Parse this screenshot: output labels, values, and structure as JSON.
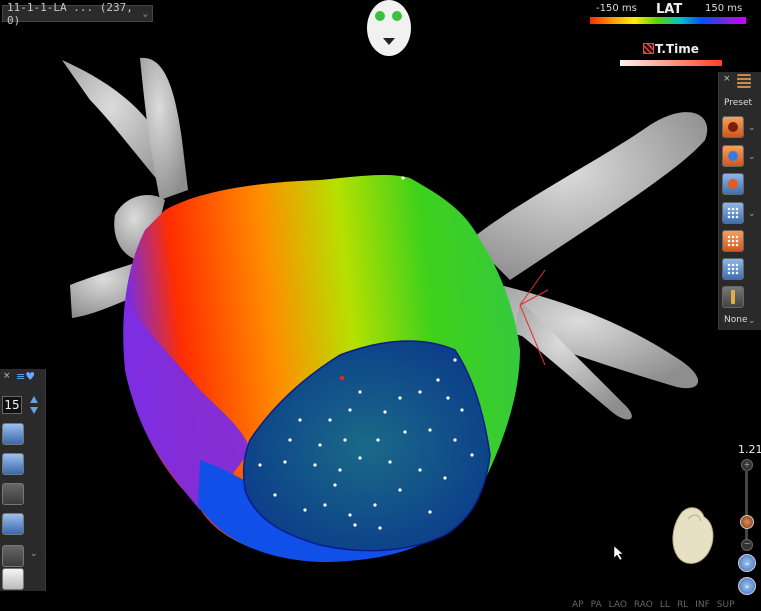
{
  "map_selector": {
    "label": "11-1-1-LA ... (237, 0)"
  },
  "legend": {
    "title": "LAT",
    "min_label": "-150 ms",
    "max_label": "150 ms",
    "ttime_label": "T.Time"
  },
  "right_toolbar": {
    "close": "×",
    "preset_label": "Preset",
    "none_label": "None"
  },
  "left_toolbar": {
    "close": "×",
    "value": "15"
  },
  "zoom": {
    "value": "1.21",
    "plus": "+",
    "minus": "−"
  },
  "view_buttons": [
    "AP",
    "PA",
    "LAO",
    "RAO",
    "LL",
    "RL",
    "INF",
    "SUP"
  ],
  "colors": {
    "background": "#000000",
    "anatomy_grey": "#b8b8b8",
    "lat_red": "#ff2a00",
    "lat_purple": "#d200ff"
  }
}
